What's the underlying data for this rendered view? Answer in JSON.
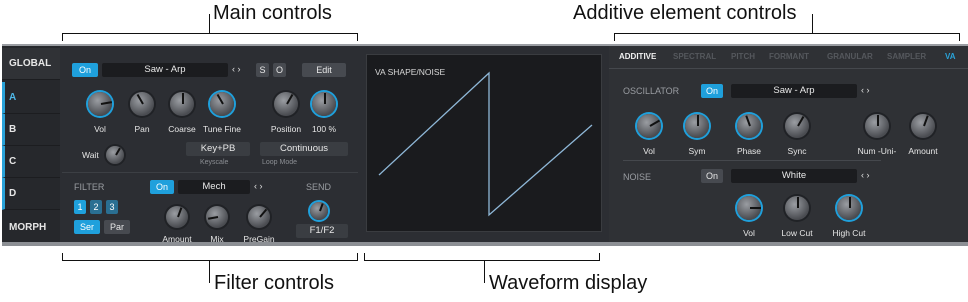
{
  "callouts": {
    "main": "Main controls",
    "additive": "Additive element controls",
    "filter": "Filter controls",
    "waveform": "Waveform display"
  },
  "nav": [
    "GLOBAL",
    "A",
    "B",
    "C",
    "D",
    "MORPH"
  ],
  "main": {
    "on_label": "On",
    "preset": "Saw - Arp",
    "nav_arrows": "‹ ›",
    "s_label": "S",
    "o_label": "O",
    "edit_label": "Edit",
    "knobs": [
      {
        "name": "Vol",
        "blue": true
      },
      {
        "name": "Pan",
        "blue": false
      },
      {
        "name": "Coarse",
        "blue": false
      },
      {
        "name": "Tune Fine",
        "blue": true
      },
      {
        "name": "Position",
        "blue": false
      },
      {
        "name": "100 %",
        "blue": true
      }
    ],
    "wait_label": "Wait",
    "keyscale_value": "Key+PB",
    "keyscale_label": "Keyscale",
    "loopmode_value": "Continuous",
    "loopmode_label": "Loop Mode"
  },
  "filter": {
    "title": "FILTER",
    "num_buttons": [
      "1",
      "2",
      "3"
    ],
    "ser_label": "Ser",
    "par_label": "Par",
    "on_label": "On",
    "type": "Mech",
    "knobs": [
      "Amount",
      "Mix",
      "PreGain"
    ],
    "send_title": "SEND",
    "send_value": "F1/F2"
  },
  "waveform": {
    "title": "VA SHAPE/NOISE"
  },
  "additive": {
    "tabs": [
      "ADDITIVE",
      "SPECTRAL",
      "PITCH",
      "FORMANT",
      "GRANULAR",
      "SAMPLER",
      "VA"
    ],
    "oscillator_title": "OSCILLATOR",
    "osc_on": "On",
    "osc_wave": "Saw - Arp",
    "osc_knobs": [
      {
        "name": "Vol",
        "blue": true
      },
      {
        "name": "Sym",
        "blue": true
      },
      {
        "name": "Phase",
        "blue": true
      },
      {
        "name": "Sync",
        "blue": false
      },
      {
        "name": "Num -Uni-",
        "blue": false
      },
      {
        "name": "Amount",
        "blue": false
      }
    ],
    "noise_title": "NOISE",
    "noise_on": "On",
    "noise_type": "White",
    "noise_knobs": [
      {
        "name": "Vol",
        "blue": true
      },
      {
        "name": "Low Cut",
        "blue": false
      },
      {
        "name": "High Cut",
        "blue": true
      }
    ]
  },
  "colors": {
    "accent": "#1fa0dc",
    "background": "#2c2e33",
    "panel": "#2f3135"
  }
}
